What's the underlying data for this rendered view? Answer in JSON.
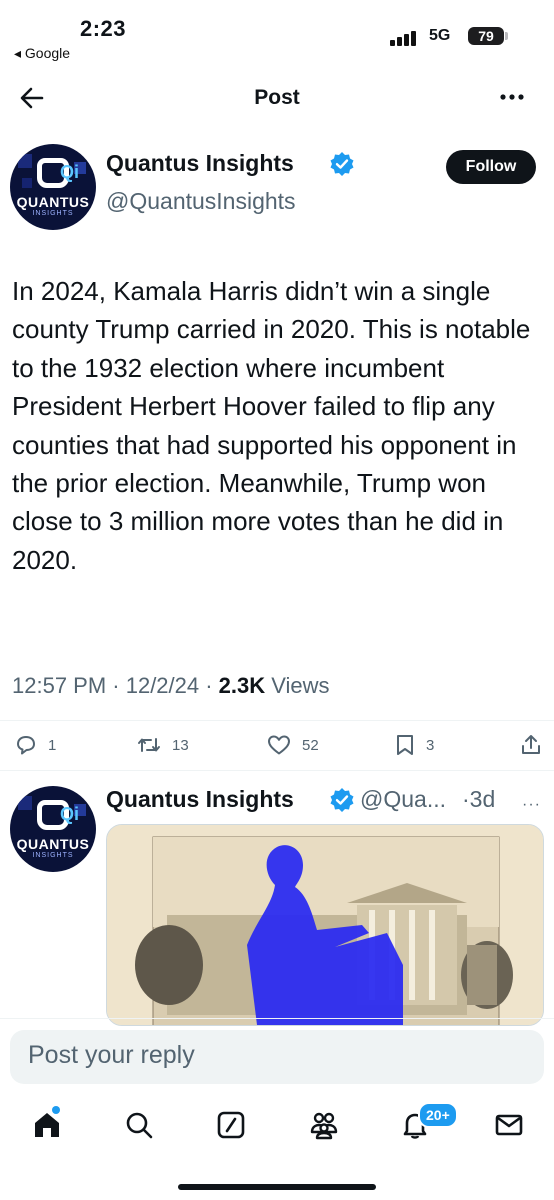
{
  "status_bar": {
    "time": "2:23",
    "back_app": "◂ Google",
    "network": "5G",
    "battery": "79"
  },
  "nav": {
    "title": "Post"
  },
  "author": {
    "display_name": "Quantus Insights",
    "handle": "@QuantusInsights",
    "follow_label": "Follow",
    "avatar_brand": "QUANTUS",
    "avatar_sub": "INSIGHTS",
    "avatar_mark": "Qi"
  },
  "post": {
    "text": "In 2024, Kamala Harris didn’t win a single county Trump carried in 2020. This is notable to the 1932 election where incumbent President Herbert Hoover failed to flip any counties that had supported his opponent in the prior election. Meanwhile, Trump won close to 3 million more votes than he did in 2020.",
    "time": "12:57 PM · 12/2/24 · ",
    "views_count": "2.3K",
    "views_label": " Views"
  },
  "actions": {
    "replies": "1",
    "reposts": "13",
    "likes": "52",
    "bookmarks": "3"
  },
  "reply_preview": {
    "display_name": "Quantus Insights",
    "handle": "@Qua...",
    "time": "·3d",
    "more": "···"
  },
  "reply_box": {
    "placeholder": "Post your reply"
  },
  "tab_bar": {
    "notifications_badge": "20+"
  },
  "colors": {
    "accent": "#1d9bf0",
    "text": "#0f1419",
    "muted": "#536471"
  }
}
